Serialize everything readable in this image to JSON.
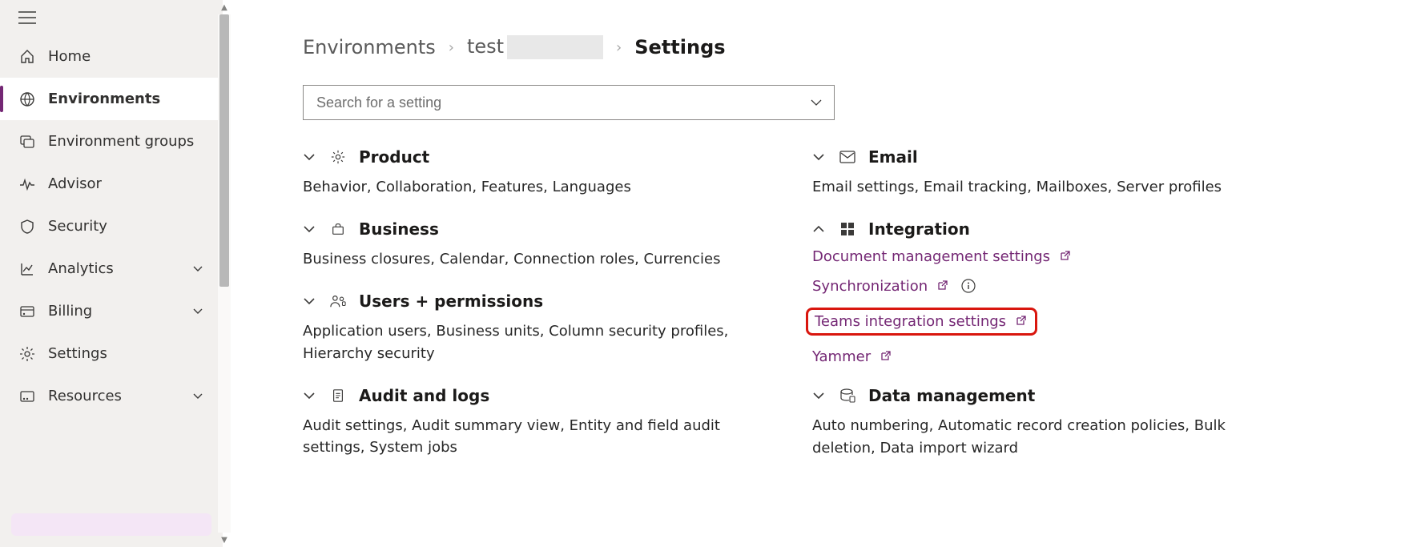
{
  "sidebar": {
    "items": [
      {
        "label": "Home"
      },
      {
        "label": "Environments"
      },
      {
        "label": "Environment groups"
      },
      {
        "label": "Advisor"
      },
      {
        "label": "Security"
      },
      {
        "label": "Analytics"
      },
      {
        "label": "Billing"
      },
      {
        "label": "Settings"
      },
      {
        "label": "Resources"
      }
    ]
  },
  "breadcrumb": {
    "root": "Environments",
    "env": "test",
    "current": "Settings"
  },
  "search": {
    "placeholder": "Search for a setting"
  },
  "sections": {
    "product": {
      "title": "Product",
      "sub": "Behavior, Collaboration, Features, Languages"
    },
    "business": {
      "title": "Business",
      "sub": "Business closures, Calendar, Connection roles, Currencies"
    },
    "users": {
      "title": "Users + permissions",
      "sub": "Application users, Business units, Column security profiles, Hierarchy security"
    },
    "audit": {
      "title": "Audit and logs",
      "sub": "Audit settings, Audit summary view, Entity and field audit settings, System jobs"
    },
    "email": {
      "title": "Email",
      "sub": "Email settings, Email tracking, Mailboxes, Server profiles"
    },
    "integration": {
      "title": "Integration",
      "links": {
        "doc": "Document management settings",
        "sync": "Synchronization",
        "teams": "Teams integration settings",
        "yammer": "Yammer"
      }
    },
    "datamgmt": {
      "title": "Data management",
      "sub": "Auto numbering, Automatic record creation policies, Bulk deletion, Data import wizard"
    }
  }
}
